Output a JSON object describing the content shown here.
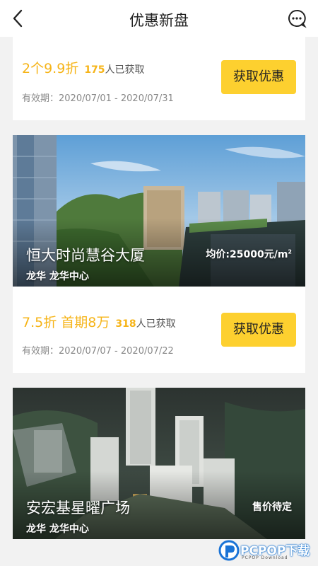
{
  "header": {
    "title": "优惠新盘",
    "back_icon": "chevron-left-icon",
    "message_icon": "chat-bubble-icon"
  },
  "offers": [
    {
      "deal": "2个9.9折",
      "count": "175",
      "count_suffix": "人已获取",
      "validity": "有效期：2020/07/01 - 2020/07/31",
      "button": "获取优惠"
    },
    {
      "deal": "7.5折 首期8万",
      "count": "318",
      "count_suffix": "人已获取",
      "validity": "有效期：2020/07/07 - 2020/07/22",
      "button": "获取优惠"
    }
  ],
  "projects": [
    {
      "name": "恒大时尚慧谷大厦",
      "area": "龙华 龙华中心",
      "price_label": "均价:25000元/m",
      "price_sup": "2"
    },
    {
      "name": "安宏基星曜广场",
      "area": "龙华 龙华中心",
      "price_label": "售价待定"
    }
  ],
  "watermark": {
    "text": "PCPOP下载",
    "sub": "PCPOP Download"
  },
  "colors": {
    "accent": "#f6b418",
    "button": "#fdd02f"
  }
}
